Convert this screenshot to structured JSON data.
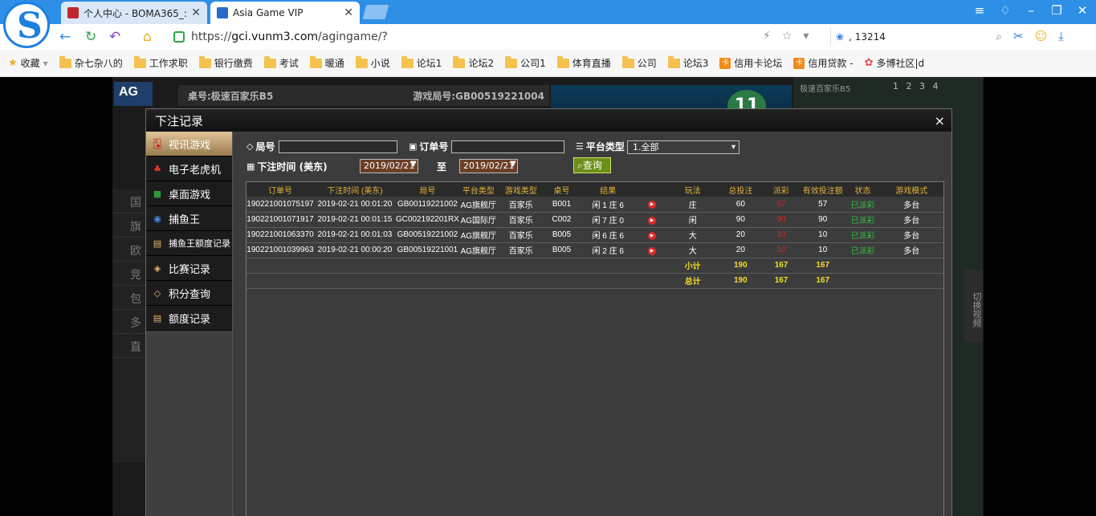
{
  "browser": {
    "tabs": [
      {
        "title": "个人中心 - BOMA365_:"
      },
      {
        "title": "Asia Game VIP"
      }
    ],
    "url_prefix": "https://",
    "url_domain": "gci.vunm3.com",
    "url_path": "/agingame/?",
    "search_text": ", 13214",
    "bookmarks": [
      "收藏",
      "杂七杂八的",
      "工作求职",
      "银行缴费",
      "考试",
      "暖通",
      "小说",
      "论坛1",
      "论坛2",
      "公司1",
      "体育直播",
      "公司",
      "论坛3",
      "信用卡论坛",
      "信用贷款 -",
      "多博社区|d"
    ]
  },
  "game": {
    "road_title": "桌号:极速百家乐B5",
    "round_text": "游戏局号:GB00519221004",
    "timer": "11",
    "right_title": "极速百家乐B5",
    "right_tabs": "1 2 3 4",
    "side_button": "切换视频",
    "left_list": [
      "国",
      "旗",
      "欧",
      "竞",
      "包",
      "多",
      "直"
    ],
    "ag": "AG"
  },
  "modal": {
    "title": "下注记录",
    "close": "×",
    "sidebar": [
      {
        "label": "视讯游戏",
        "icon": "cards-icon",
        "active": true
      },
      {
        "label": "电子老虎机",
        "icon": "slot-icon"
      },
      {
        "label": "桌面游戏",
        "icon": "table-icon"
      },
      {
        "label": "捕鱼王",
        "icon": "fish-icon"
      },
      {
        "label": "捕鱼王额度记录",
        "icon": "note-icon"
      },
      {
        "label": "比赛记录",
        "icon": "ticket-icon"
      },
      {
        "label": "积分查询",
        "icon": "diamond-icon"
      },
      {
        "label": "额度记录",
        "icon": "note-icon"
      }
    ],
    "filters": {
      "round_label": "局号",
      "order_label": "订单号",
      "platform_label": "平台类型",
      "platform_value": "1.全部",
      "time_label": "下注时间 (美东)",
      "date_from": "2019/02/21",
      "to_label": "至",
      "date_to": "2019/02/21",
      "query_label": "查询"
    },
    "table": {
      "headers": [
        "订单号",
        "下注时间 (美东)",
        "局号",
        "平台类型",
        "游戏类型",
        "桌号",
        "结果",
        "",
        "玩法",
        "总投注",
        "派彩",
        "有效投注额",
        "状态",
        "游戏模式"
      ],
      "rows": [
        {
          "order": "190221001075197",
          "time": "2019-02-21 00:01:20",
          "round": "GB00119221002",
          "platform": "AG旗舰厅",
          "game": "百家乐",
          "table": "B001",
          "result": "闲 1 庄 6",
          "play": "庄",
          "bet": "60",
          "payout": "57",
          "valid": "57",
          "status": "已派彩",
          "mode": "多台"
        },
        {
          "order": "190221001071917",
          "time": "2019-02-21 00:01:15",
          "round": "GC002192201RX",
          "platform": "AG国际厅",
          "game": "百家乐",
          "table": "C002",
          "result": "闲 7 庄 0",
          "play": "闲",
          "bet": "90",
          "payout": "90",
          "valid": "90",
          "status": "已派彩",
          "mode": "多台"
        },
        {
          "order": "190221001063370",
          "time": "2019-02-21 00:01:03",
          "round": "GB00519221002",
          "platform": "AG旗舰厅",
          "game": "百家乐",
          "table": "B005",
          "result": "闲 6 庄 6",
          "play": "大",
          "bet": "20",
          "payout": "10",
          "valid": "10",
          "status": "已派彩",
          "mode": "多台"
        },
        {
          "order": "190221001039963",
          "time": "2019-02-21 00:00:20",
          "round": "GB00519221001",
          "platform": "AG旗舰厅",
          "game": "百家乐",
          "table": "B005",
          "result": "闲 2 庄 6",
          "play": "大",
          "bet": "20",
          "payout": "10",
          "valid": "10",
          "status": "已派彩",
          "mode": "多台"
        }
      ],
      "subtotal": {
        "label": "小计",
        "bet": "190",
        "payout": "167",
        "valid": "167"
      },
      "total": {
        "label": "总计",
        "bet": "190",
        "payout": "167",
        "valid": "167"
      }
    }
  }
}
